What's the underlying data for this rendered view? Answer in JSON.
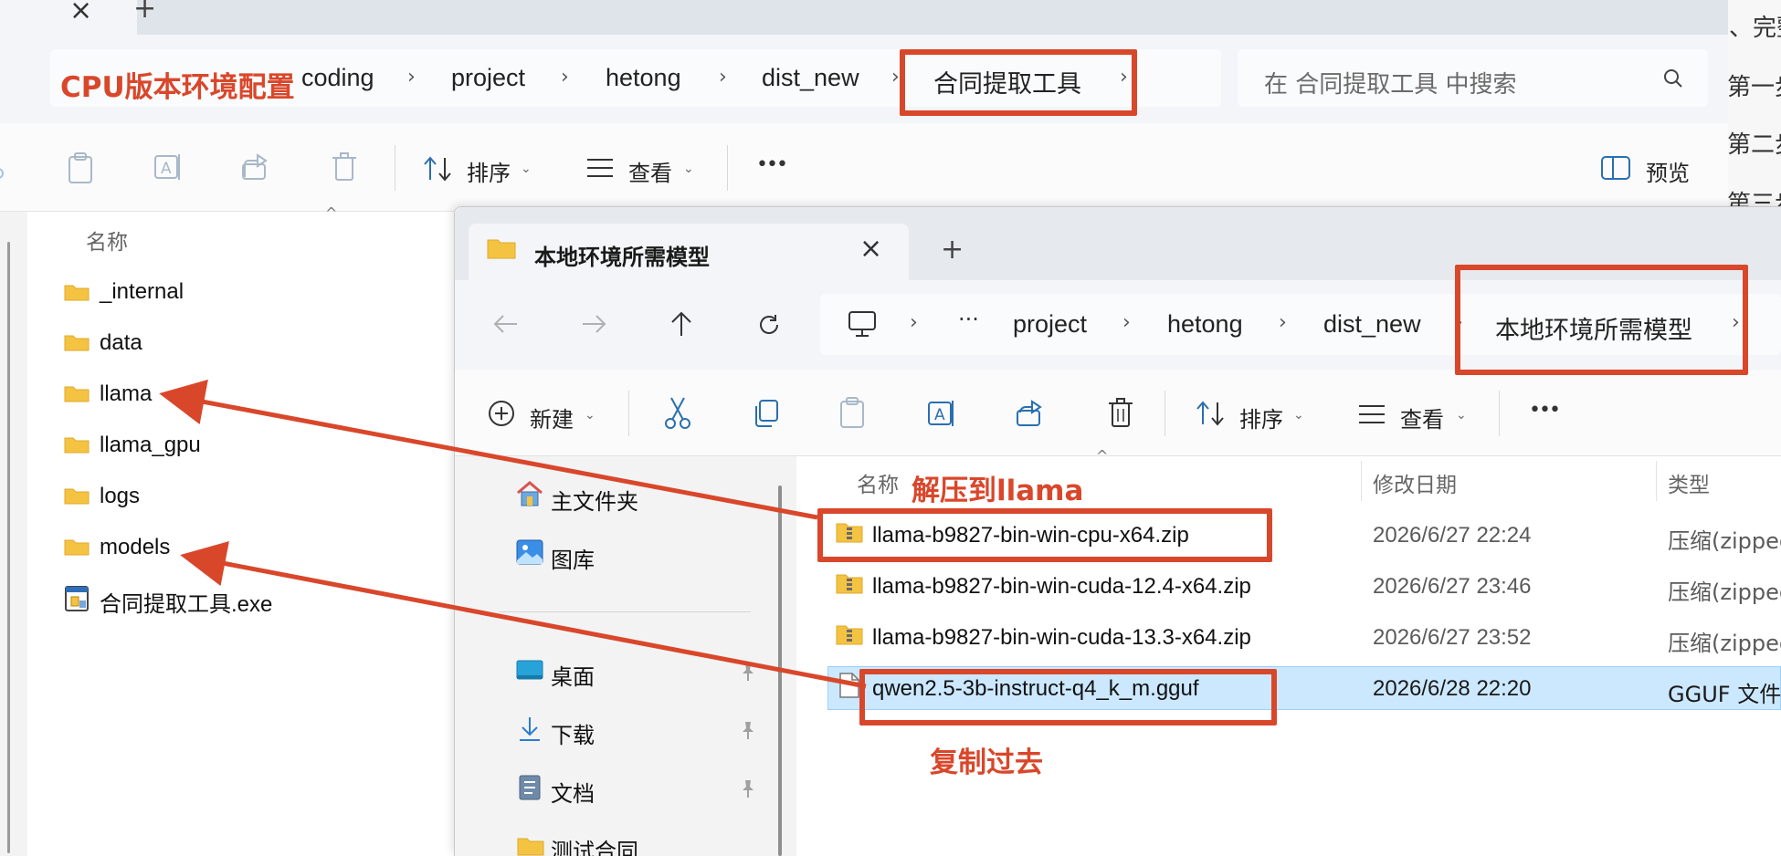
{
  "back_window": {
    "tab_close": "×",
    "new_tab": "+",
    "breadcrumb": [
      "coding",
      "project",
      "hetong",
      "dist_new",
      "合同提取工具"
    ],
    "search_placeholder": "在 合同提取工具 中搜索",
    "commands": {
      "sort_label": "排序",
      "view_label": "查看",
      "more_label": "•••",
      "preview_label": "预览"
    },
    "column_name": "名称",
    "items": [
      {
        "name": "_internal",
        "icon": "folder-icon"
      },
      {
        "name": "data",
        "icon": "folder-icon"
      },
      {
        "name": "llama",
        "icon": "folder-icon"
      },
      {
        "name": "llama_gpu",
        "icon": "folder-icon"
      },
      {
        "name": "logs",
        "icon": "folder-icon"
      },
      {
        "name": "models",
        "icon": "folder-icon"
      },
      {
        "name": "合同提取工具.exe",
        "icon": "executable-icon"
      }
    ]
  },
  "front_window": {
    "tab_title": "本地环境所需模型",
    "tab_close": "×",
    "new_tab": "+",
    "breadcrumb_ellipsis": "···",
    "breadcrumb": [
      "project",
      "hetong",
      "dist_new",
      "本地环境所需模型"
    ],
    "commands": {
      "new_label": "新建",
      "sort_label": "排序",
      "view_label": "查看",
      "more_label": "•••"
    },
    "nav": [
      {
        "label": "主文件夹",
        "icon": "home-icon"
      },
      {
        "label": "图库",
        "icon": "gallery-icon"
      },
      {
        "label": "桌面",
        "icon": "desktop-icon"
      },
      {
        "label": "下载",
        "icon": "download-icon"
      },
      {
        "label": "文档",
        "icon": "documents-icon"
      },
      {
        "label": "测试合同",
        "icon": "folder-icon"
      }
    ],
    "columns": {
      "name": "名称",
      "date": "修改日期",
      "type": "类型"
    },
    "files": [
      {
        "name": "llama-b9827-bin-win-cpu-x64.zip",
        "date": "2026/6/27 22:24",
        "type": "压缩(zipped",
        "icon": "zip-folder-icon",
        "selected": false
      },
      {
        "name": "llama-b9827-bin-win-cuda-12.4-x64.zip",
        "date": "2026/6/27 23:46",
        "type": "压缩(zipped",
        "icon": "zip-folder-icon",
        "selected": false
      },
      {
        "name": "llama-b9827-bin-win-cuda-13.3-x64.zip",
        "date": "2026/6/27 23:52",
        "type": "压缩(zipped",
        "icon": "zip-folder-icon",
        "selected": false
      },
      {
        "name": "qwen2.5-3b-instruct-q4_k_m.gguf",
        "date": "2026/6/28 22:20",
        "type": "GGUF 文件",
        "icon": "file-icon",
        "selected": true
      }
    ]
  },
  "annotations": {
    "title": "CPU版本环境配置",
    "unzip": "解压到llama",
    "copy": "复制过去",
    "color": "#d9472b"
  },
  "background_doc": {
    "lines": [
      "、完整",
      "第一步",
      "第二步",
      "第三步"
    ]
  },
  "colors": {
    "folder": "#f5c342",
    "selection": "#cce8ff",
    "accent": "#0067c0"
  }
}
